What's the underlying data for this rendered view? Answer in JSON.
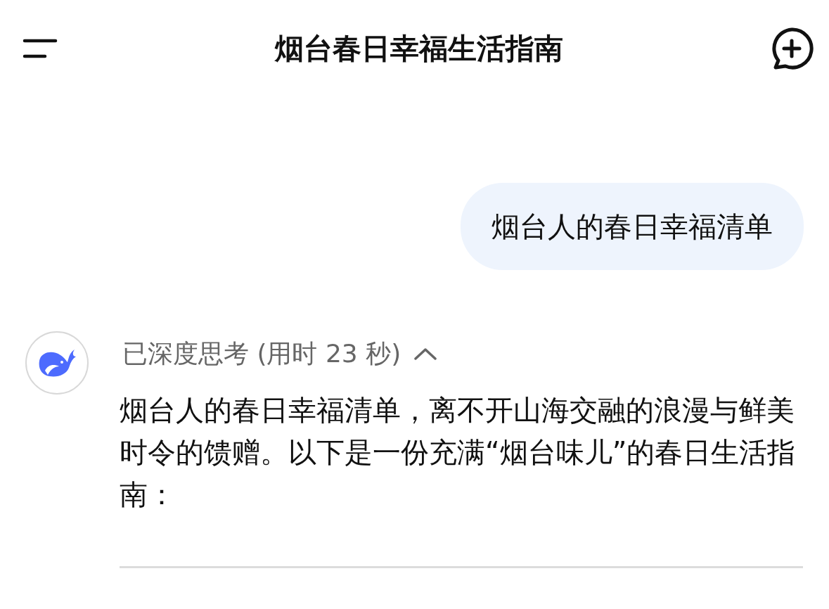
{
  "header": {
    "title": "烟台春日幸福生活指南"
  },
  "user_message": {
    "text": "烟台人的春日幸福清单"
  },
  "reply": {
    "thinking": {
      "label": "已深度思考 (用时 23 秒)",
      "expanded": true
    },
    "paragraph": "烟台人的春日幸福清单，离不开山海交融的浪漫与鲜美时令的馈赠。以下是一份充满“烟台味儿”的春日生活指南："
  }
}
